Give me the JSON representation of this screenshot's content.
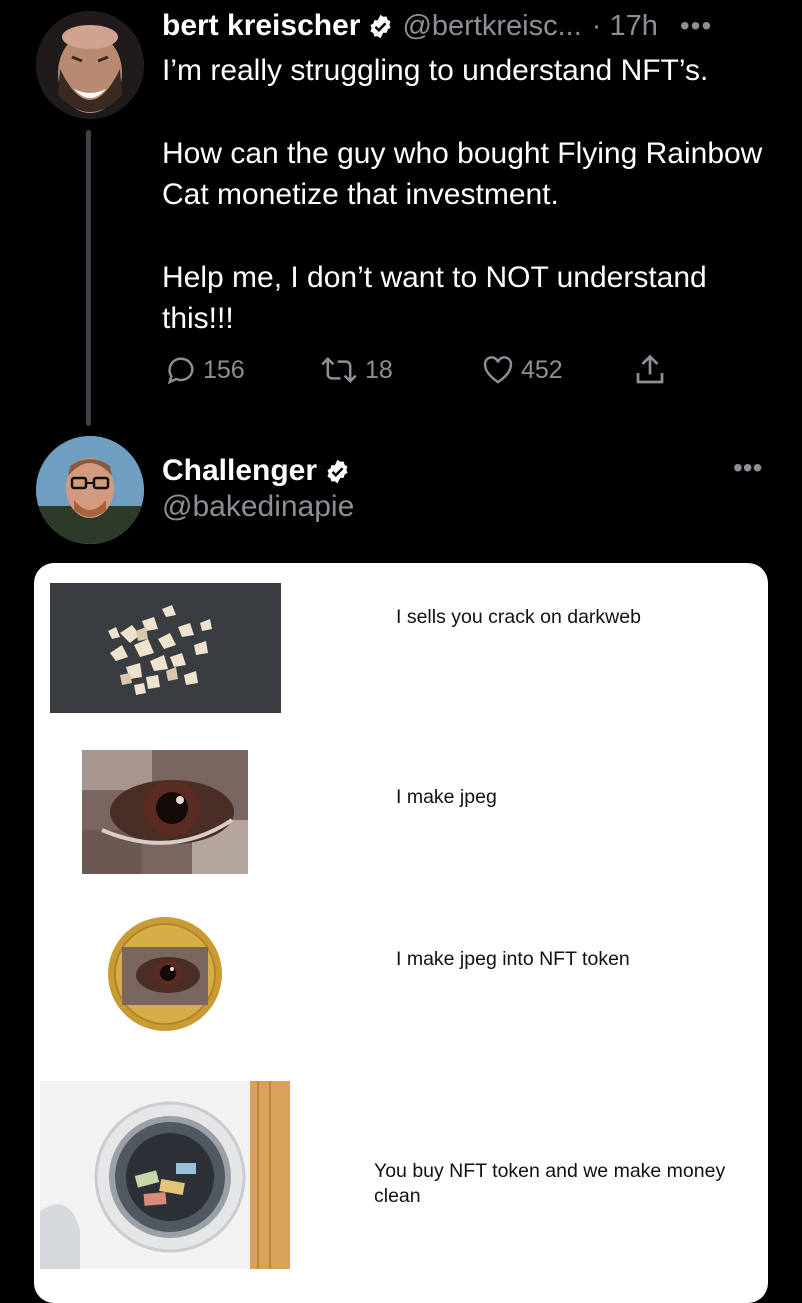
{
  "tweet1": {
    "name": "bert kreischer",
    "handle": "@bertkreisc...",
    "time": "· 17h",
    "menu": "•••",
    "paragraphs": [
      "I’m really struggling to understand NFT’s.",
      "How can the guy who bought Flying Rainbow Cat monetize that investment.",
      "Help me, I don’t want to NOT understand this!!!"
    ],
    "replies": "156",
    "retweets": "18",
    "likes": "452",
    "icons": [
      "reply-icon",
      "retweet-icon",
      "like-icon",
      "share-icon",
      "verified-badge-icon"
    ]
  },
  "tweet2": {
    "name": "Challenger",
    "handle": "@bakedinapie",
    "menu": "•••"
  },
  "meme": {
    "captions": [
      "I sells you crack on darkweb",
      "I make jpeg",
      "I make jpeg into NFT token",
      "You buy NFT token and we make money clean"
    ]
  },
  "colors": {
    "background": "#000000",
    "text": "#ffffff",
    "muted": "#8b9096",
    "verified": "#ffffff",
    "card": "#ffffff"
  }
}
